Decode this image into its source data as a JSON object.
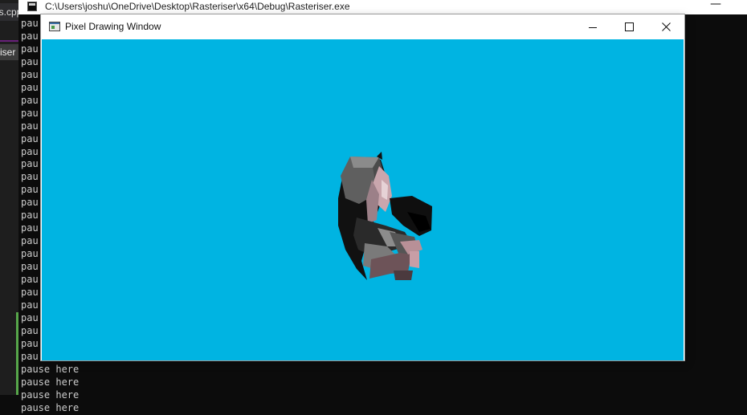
{
  "editor": {
    "tab_file": "es.cpp",
    "tab_project": "riser"
  },
  "console": {
    "title": "C:\\Users\\joshu\\OneDrive\\Desktop\\Rasteriser\\x64\\Debug\\Rasteriser.exe",
    "minimize_glyph": "—",
    "lines": [
      "pau",
      "pau",
      "pau",
      "pau",
      "pau",
      "pau",
      "pau",
      "pau",
      "pau",
      "pau",
      "pau",
      "pau",
      "pau",
      "pau",
      "pau",
      "pau",
      "pau",
      "pau",
      "pau",
      "pau",
      "pau",
      "pau",
      "pau",
      "pau",
      "pau",
      "pau",
      "pau",
      "pause here",
      "pause here",
      "pause here",
      "pause here"
    ]
  },
  "window": {
    "title": "Pixel Drawing Window",
    "minimize_glyph": "—",
    "close_glyph": "✕"
  },
  "scene": {
    "background_color": "#00b4e2",
    "object": "monkey-model"
  }
}
